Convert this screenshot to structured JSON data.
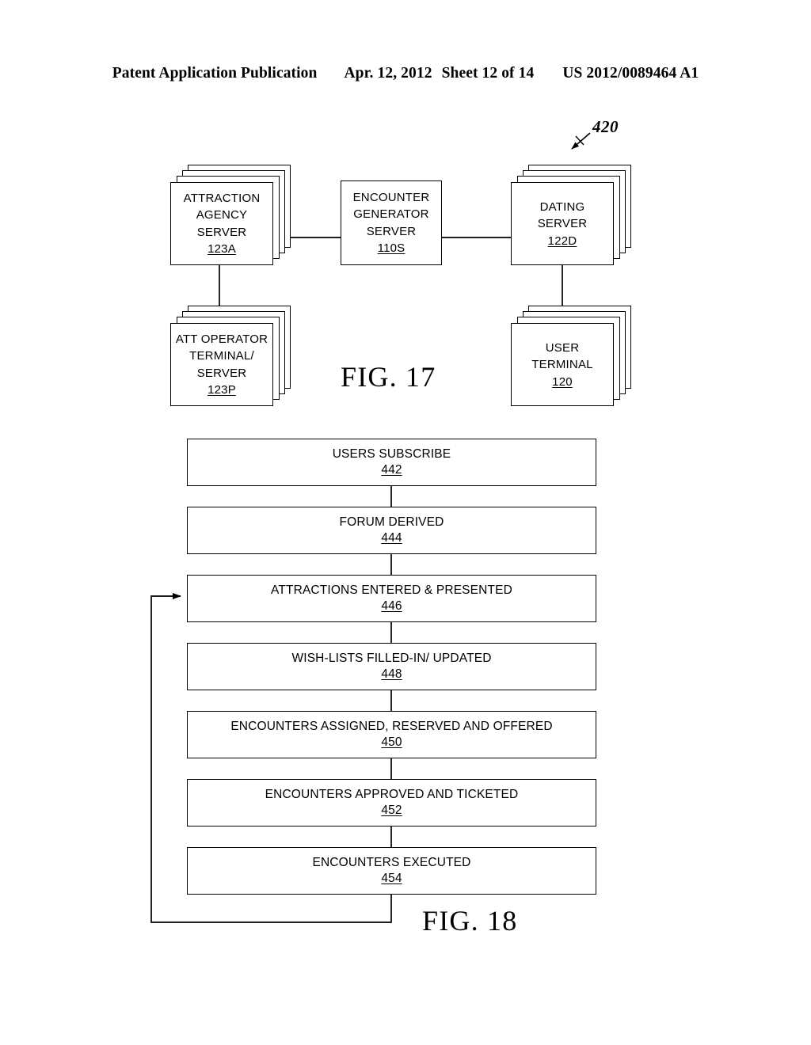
{
  "header": {
    "publication": "Patent Application Publication",
    "date": "Apr. 12, 2012",
    "sheet": "Sheet 12 of 14",
    "patent_number": "US 2012/0089464 A1"
  },
  "fig17": {
    "title": "FIG. 17",
    "callout": "420",
    "nodes": [
      {
        "id": "attraction-agency-server",
        "lines": [
          "ATTRACTION",
          "AGENCY",
          "SERVER"
        ],
        "ref": "123A",
        "stacked": true
      },
      {
        "id": "encounter-generator-server",
        "lines": [
          "ENCOUNTER",
          "GENERATOR",
          "SERVER"
        ],
        "ref": "110S",
        "stacked": false
      },
      {
        "id": "dating-server",
        "lines": [
          "DATING",
          "SERVER"
        ],
        "ref": "122D",
        "stacked": true
      },
      {
        "id": "att-operator-terminal-server",
        "lines": [
          "ATT OPERATOR",
          "TERMINAL/",
          "SERVER"
        ],
        "ref": "123P",
        "stacked": true
      },
      {
        "id": "user-terminal",
        "lines": [
          "USER",
          "TERMINAL"
        ],
        "ref": "120",
        "stacked": true
      }
    ]
  },
  "fig18": {
    "title": "FIG. 18",
    "steps": [
      {
        "id": "users-subscribe",
        "label": "USERS SUBSCRIBE",
        "ref": "442"
      },
      {
        "id": "forum-derived",
        "label": "FORUM DERIVED",
        "ref": "444"
      },
      {
        "id": "attractions-entered",
        "label": "ATTRACTIONS ENTERED & PRESENTED",
        "ref": "446"
      },
      {
        "id": "wish-lists-updated",
        "label": "WISH-LISTS FILLED-IN/ UPDATED",
        "ref": "448"
      },
      {
        "id": "encounters-assigned",
        "label": "ENCOUNTERS ASSIGNED, RESERVED AND OFFERED",
        "ref": "450"
      },
      {
        "id": "encounters-approved",
        "label": "ENCOUNTERS APPROVED AND TICKETED",
        "ref": "452"
      },
      {
        "id": "encounters-executed",
        "label": "ENCOUNTERS EXECUTED",
        "ref": "454"
      }
    ]
  },
  "colors": {
    "ink": "#000000",
    "paper": "#ffffff"
  }
}
